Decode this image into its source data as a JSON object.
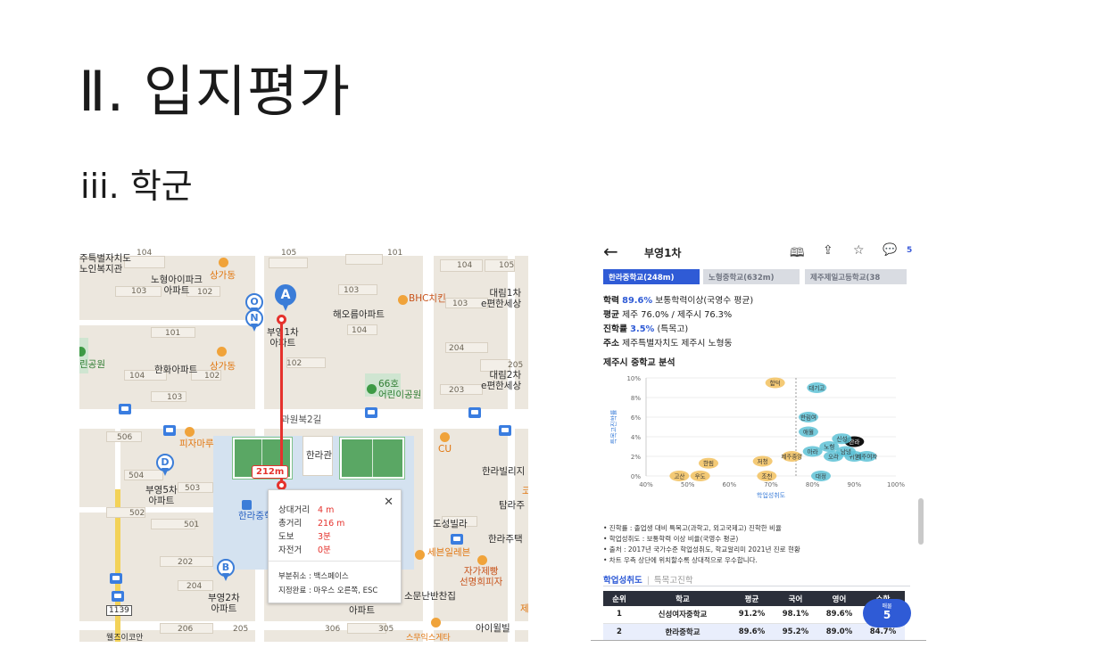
{
  "slide": {
    "title": "Ⅱ. 입지평가",
    "subtitle": "iii. 학군"
  },
  "map": {
    "labels": {
      "nursing": "주특별자치도\n노인복지관",
      "nohyeong_ipark": "노형아이파크\n아파트",
      "sangga1": "상가동",
      "sangga2": "상가동",
      "bhc": "BHC치킨",
      "haeorum": "해오름아파트",
      "daerim1": "대림1차\ne편한세상",
      "daerim2": "대림2차\ne편한세상",
      "buyoung1": "부영1차\n아파트",
      "hanhwa": "한화아파트",
      "park": "린공원",
      "kids_park": "66호\n어린이공원",
      "road_name": "과원북2길",
      "pizza": "피자마루",
      "hallagwan": "한라관",
      "cu": "CU",
      "hallavilla": "한라빌리지",
      "tamra": "탐라주",
      "buyoung5": "부영5차\n아파트",
      "hallamid": "한라중학",
      "dosung": "도성빌라",
      "hallajutaek": "한라주택",
      "sebun": "세븐일레븐",
      "pizza2": "자가제빵\n선명희피자",
      "buyoung2": "부영2차\n아파트",
      "somun": "소문난반찬집",
      "apt": "아파트",
      "ivill": "아이윌빌",
      "bus": "1139",
      "bottom1": "웰즈이코안",
      "bottom2": "스무익스게타",
      "ko_char": "코",
      "je_char": "제"
    },
    "bnums": [
      "104",
      "105",
      "101",
      "102",
      "104",
      "105",
      "103",
      "102",
      "103",
      "103",
      "101",
      "104",
      "204",
      "205",
      "104",
      "102",
      "102",
      "103",
      "203",
      "506",
      "504",
      "503",
      "502",
      "501",
      "202",
      "204",
      "206",
      "205",
      "306",
      "305",
      "103",
      "101"
    ],
    "pins": {
      "a": "A",
      "b": "B",
      "d": "D",
      "o": "O",
      "n": "N"
    },
    "route_distance": "212m",
    "popup": {
      "rel_label": "상대거리",
      "rel_value": "4 m",
      "total_label": "총거리",
      "total_value": "216 m",
      "walk_label": "도보",
      "walk_value": "3분",
      "bike_label": "자전거",
      "bike_value": "0분",
      "cancel": "부분취소 : 백스페이스",
      "finish": "지정완료 : 마우스 오른쪽, ESC",
      "close": "✕"
    }
  },
  "panel": {
    "back": "←",
    "title": "부영1차",
    "icons": [
      "map-icon",
      "share-icon",
      "star-icon",
      "chat-icon"
    ],
    "comment_count": "5",
    "tabs": [
      "한라중학교(248m)",
      "노형중학교(632m)",
      "제주제일고등학교(38"
    ],
    "academic": {
      "label": "학력",
      "value": "89.6%",
      "desc": "보통학력이상(국영수 평균)"
    },
    "average": {
      "label": "평균",
      "text": "제주 76.0% / 제주시 76.3%"
    },
    "progress": {
      "label": "진학률",
      "value": "3.5%",
      "desc": "(특목고)"
    },
    "address": {
      "label": "주소",
      "text": "제주특별자치도 제주시 노형동"
    },
    "section_title": "제주시 중학교 분석",
    "notes": [
      "• 진학률 : 졸업생 대비 특목고(과학고, 외고국제고) 진학한 비율",
      "• 학업성취도 : 보통학력 이상 비율(국영수 평균)",
      "• 출처 : 2017년 국가수준 학업성취도, 학교알리미 2021년 진로 현황",
      "• 차트 우측 상단에 위치할수록 상대적으로 우수합니다."
    ],
    "subtabs": {
      "active": "학업성취도",
      "inactive": "특목고진학"
    },
    "table": {
      "headers": [
        "순위",
        "학교",
        "평균",
        "국어",
        "영어",
        "수학"
      ],
      "rows": [
        [
          "1",
          "신성여자중학교",
          "91.2%",
          "98.1%",
          "89.6%",
          "8"
        ],
        [
          "2",
          "한라중학교",
          "89.6%",
          "95.2%",
          "89.0%",
          "84.7%"
        ]
      ]
    },
    "badge": {
      "small": "매물",
      "num": "5"
    }
  },
  "chart_data": {
    "type": "scatter",
    "title": "제주시 중학교 분석",
    "xlabel": "학업성취도",
    "ylabel": "특목고진학률",
    "xlim": [
      40,
      100
    ],
    "ylim": [
      0,
      10
    ],
    "xticks": [
      "40%",
      "50%",
      "60%",
      "70%",
      "80%",
      "90%",
      "100%"
    ],
    "yticks": [
      "0%",
      "2%",
      "4%",
      "6%",
      "8%",
      "10%"
    ],
    "colors": {
      "low": "#f2c15e",
      "high": "#5ec2d6",
      "highlight": "#111111"
    },
    "points": [
      {
        "label": "고산",
        "x": 48,
        "y": 0.0,
        "color": "low"
      },
      {
        "label": "우도",
        "x": 53,
        "y": 0.0,
        "color": "low"
      },
      {
        "label": "한림",
        "x": 55,
        "y": 1.3,
        "color": "low"
      },
      {
        "label": "조천",
        "x": 69,
        "y": 0.0,
        "color": "low"
      },
      {
        "label": "함덕",
        "x": 71,
        "y": 9.5,
        "color": "low"
      },
      {
        "label": "저청",
        "x": 68,
        "y": 1.5,
        "color": "low"
      },
      {
        "label": "제주중앙",
        "x": 75,
        "y": 2.0,
        "color": "low"
      },
      {
        "label": "한라",
        "x": 90,
        "y": 3.5,
        "color": "highlight"
      },
      {
        "label": "신성",
        "x": 87,
        "y": 3.8,
        "color": "high"
      },
      {
        "label": "노형",
        "x": 84,
        "y": 3.0,
        "color": "high"
      },
      {
        "label": "아라",
        "x": 80,
        "y": 2.5,
        "color": "high"
      },
      {
        "label": "애월",
        "x": 79,
        "y": 4.5,
        "color": "high"
      },
      {
        "label": "한림여",
        "x": 79,
        "y": 6.0,
        "color": "high"
      },
      {
        "label": "대기고",
        "x": 81,
        "y": 9.0,
        "color": "high"
      },
      {
        "label": "오라",
        "x": 85,
        "y": 2.0,
        "color": "high"
      },
      {
        "label": "귀일",
        "x": 90,
        "y": 2.0,
        "color": "high"
      },
      {
        "label": "제주여자",
        "x": 93,
        "y": 2.0,
        "color": "high"
      },
      {
        "label": "대정",
        "x": 82,
        "y": 0.0,
        "color": "high"
      },
      {
        "label": "남녕",
        "x": 88,
        "y": 2.5,
        "color": "high"
      }
    ]
  }
}
